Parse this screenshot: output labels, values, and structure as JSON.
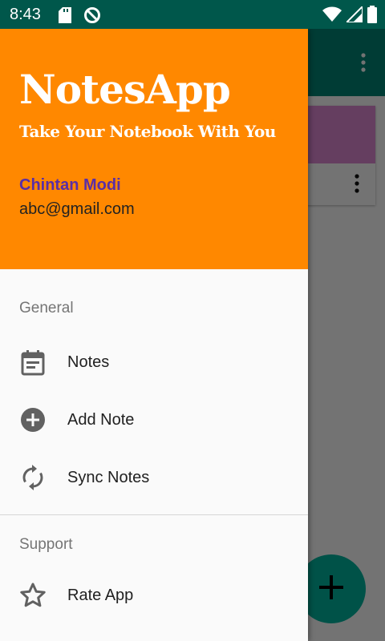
{
  "status_bar": {
    "time": "8:43"
  },
  "drawer": {
    "app_name": "NotesApp",
    "tagline": "Take Your Notebook With You",
    "user_name": "Chintan Modi",
    "user_email": "abc@gmail.com",
    "sections": [
      {
        "title": "General",
        "items": [
          {
            "label": "Notes",
            "icon": "notes-calendar-icon"
          },
          {
            "label": "Add Note",
            "icon": "add-circle-icon"
          },
          {
            "label": "Sync Notes",
            "icon": "sync-icon"
          }
        ]
      },
      {
        "title": "Support",
        "items": [
          {
            "label": "Rate App",
            "icon": "star-outline-icon"
          }
        ]
      }
    ]
  },
  "colors": {
    "header_orange": "#ff8800",
    "status_bar": "#00574b",
    "user_name": "#5a2ea6"
  }
}
